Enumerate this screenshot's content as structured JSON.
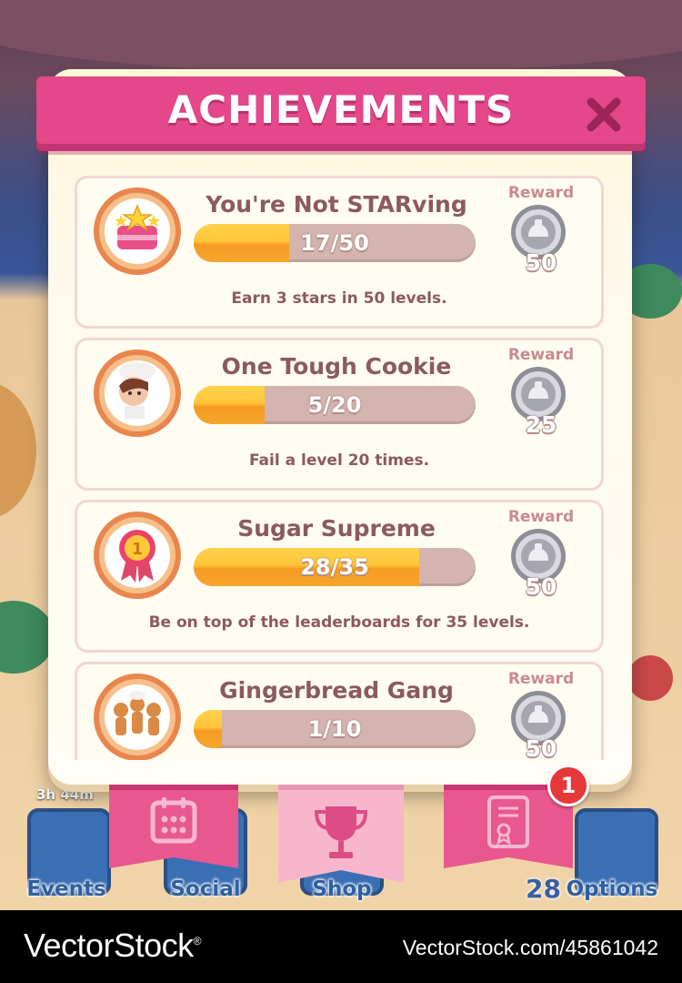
{
  "title": "ACHIEVEMENTS",
  "reward_label": "Reward",
  "achievements": [
    {
      "name": "You're Not STARving",
      "current": 17,
      "total": 50,
      "progress_text": "17/50",
      "description": "Earn 3 stars in 50 levels.",
      "reward": "50",
      "badge": "star-cake-icon"
    },
    {
      "name": "One Tough Cookie",
      "current": 5,
      "total": 20,
      "progress_text": "5/20",
      "description": "Fail a level 20 times.",
      "reward": "25",
      "badge": "chef-icon"
    },
    {
      "name": "Sugar Supreme",
      "current": 28,
      "total": 35,
      "progress_text": "28/35",
      "description": "Be on top of the leaderboards for 35 levels.",
      "reward": "50",
      "badge": "first-place-ribbon-icon"
    },
    {
      "name": "Gingerbread Gang",
      "current": 1,
      "total": 10,
      "progress_text": "1/10",
      "description": "",
      "reward": "50",
      "badge": "gingerbread-men-icon"
    }
  ],
  "tabs": [
    {
      "name": "calendar-icon",
      "active": false
    },
    {
      "name": "trophy-icon",
      "active": true
    },
    {
      "name": "certificate-icon",
      "active": false
    }
  ],
  "notification_count": "1",
  "background": {
    "timer": "3h 44m",
    "buttons": [
      "Events",
      "Social",
      "Shop",
      "Options"
    ],
    "level": "28"
  },
  "watermark": {
    "brand": "VectorStock",
    "brand_mark": "®",
    "id": "VectorStock.com/45861042"
  },
  "colors": {
    "accent_pink": "#e4478a",
    "progress_orange": "#f79a22",
    "card_bg": "#fffcf2",
    "text_brown": "#8b5a5e"
  }
}
